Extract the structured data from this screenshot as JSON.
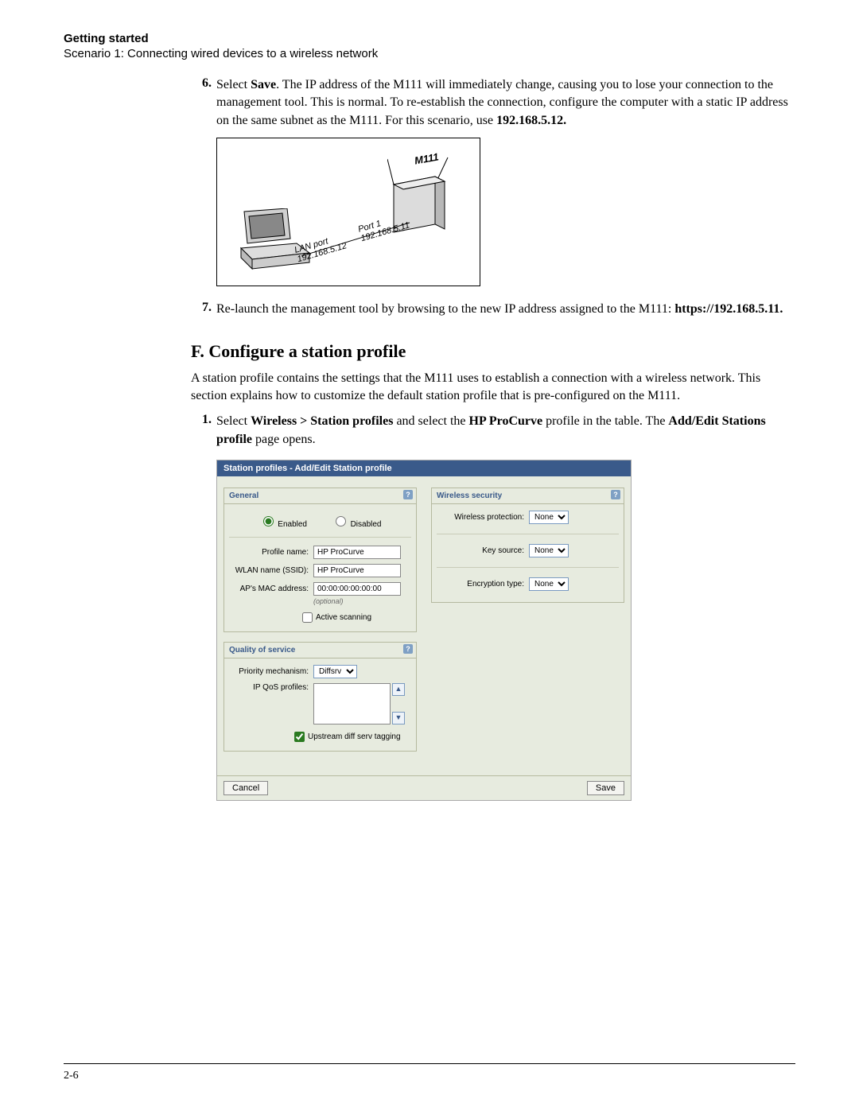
{
  "header": {
    "chapter": "Getting started",
    "section": "Scenario 1: Connecting wired devices to a wireless network"
  },
  "step6": {
    "num": "6.",
    "pre": "Select ",
    "bold1": "Save",
    "mid": ". The IP address of the M111 will immediately change, causing you to lose your connection to the management tool. This is normal. To re-establish the connection, configure the computer with a static IP address on the same subnet as the M111. For this scenario, use ",
    "bold2": "192.168.5.12."
  },
  "diagram": {
    "device": "M111",
    "port1": "Port 1",
    "ip1": "192.168.5.11",
    "lanport": "LAN port",
    "ip2": "192.168.5.12"
  },
  "step7": {
    "num": "7.",
    "pre": "Re-launch the management tool by browsing to the new IP address assigned to the M111: ",
    "bold1": "https://192.168.5.11."
  },
  "sectionF": {
    "heading": "F.  Configure a station profile",
    "intro": "A station profile contains the settings that the M111 uses to establish a connection with a wireless network. This section explains how to customize the default station profile that is pre-configured on the M111."
  },
  "step1": {
    "num": "1.",
    "pre": "Select ",
    "bold1": "Wireless > Station profiles",
    "mid1": " and select the ",
    "bold2": "HP ProCurve",
    "mid2": " profile in the table. The ",
    "bold3": "Add/Edit Stations profile",
    "post": " page opens."
  },
  "screenshot": {
    "title": "Station profiles - Add/Edit Station profile",
    "general": {
      "title": "General",
      "enabled": "Enabled",
      "disabled": "Disabled",
      "profile_name_label": "Profile name:",
      "profile_name": "HP ProCurve",
      "wlan_label": "WLAN name (SSID):",
      "wlan": "HP ProCurve",
      "mac_label": "AP's MAC address:",
      "mac": "00:00:00:00:00:00",
      "optional": "(optional)",
      "active_scanning": "Active scanning"
    },
    "qos": {
      "title": "Quality of service",
      "priority_label": "Priority mechanism:",
      "priority": "Diffsrv",
      "ipqos_label": "IP QoS profiles:",
      "upstream": "Upstream diff serv tagging"
    },
    "wireless": {
      "title": "Wireless security",
      "protection_label": "Wireless protection:",
      "protection": "None",
      "keysource_label": "Key source:",
      "keysource": "None",
      "enc_label": "Encryption type:",
      "enc": "None"
    },
    "buttons": {
      "cancel": "Cancel",
      "save": "Save"
    }
  },
  "footer": {
    "page": "2-6"
  }
}
